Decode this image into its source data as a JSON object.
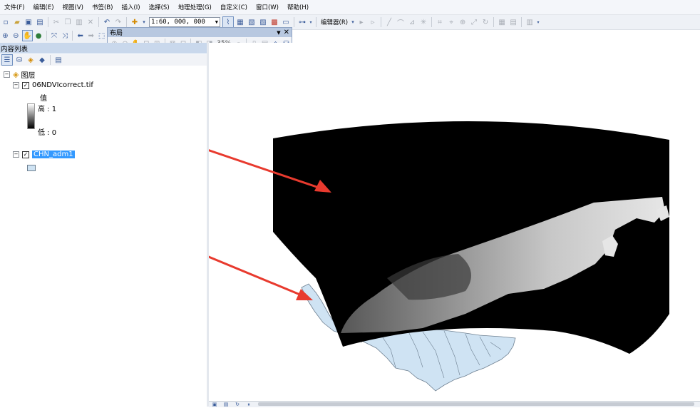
{
  "menubar": {
    "items": [
      "文件(F)",
      "编辑(E)",
      "视图(V)",
      "书签(B)",
      "插入(I)",
      "选择(S)",
      "地理处理(G)",
      "自定义(C)",
      "窗口(W)",
      "帮助(H)"
    ]
  },
  "toolbar": {
    "scale_value": "1:60, 000, 000",
    "editor_label": "编辑器(R)"
  },
  "layout_toolbar": {
    "title": "布局",
    "zoom_value": "35%"
  },
  "toc": {
    "title": "内容列表",
    "root_label": "图层",
    "layers": [
      {
        "name": "06NDVIcorrect.tif",
        "legend_title": "值",
        "legend_high": "高 : 1",
        "legend_low": "低 : 0"
      },
      {
        "name": "CHN_adm1"
      }
    ]
  },
  "colors": {
    "ndvi_background": "#000000",
    "boundary_fill": "#cfe3f3",
    "arrow": "#e83a2e",
    "selection": "#3399ff"
  }
}
